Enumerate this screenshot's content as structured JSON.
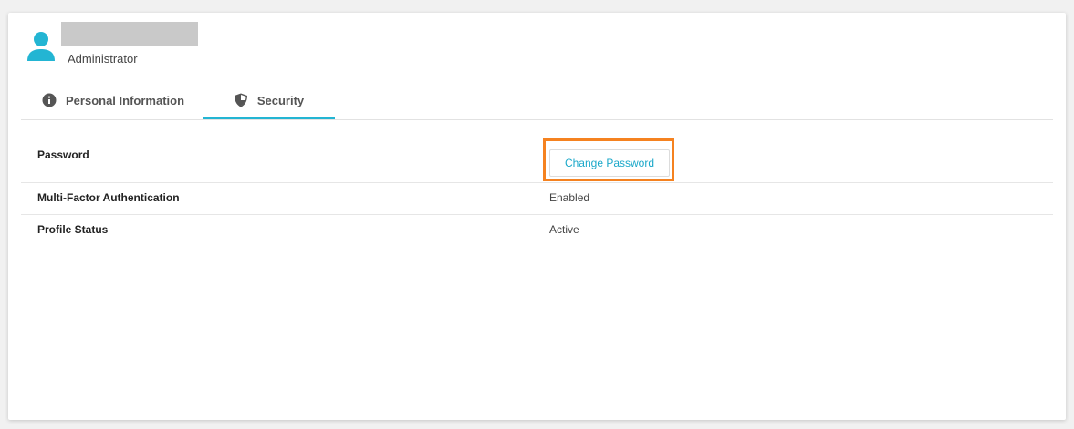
{
  "profile": {
    "role": "Administrator",
    "avatar_icon": "user-icon",
    "accent_color": "#23b5d3"
  },
  "tabs": [
    {
      "label": "Personal Information",
      "icon": "info-icon",
      "active": false
    },
    {
      "label": "Security",
      "icon": "shield-icon",
      "active": true
    }
  ],
  "security": {
    "password_label": "Password",
    "change_password_label": "Change Password",
    "mfa_label": "Multi-Factor Authentication",
    "mfa_value": "Enabled",
    "status_label": "Profile Status",
    "status_value": "Active"
  },
  "highlight_color": "#f58220"
}
